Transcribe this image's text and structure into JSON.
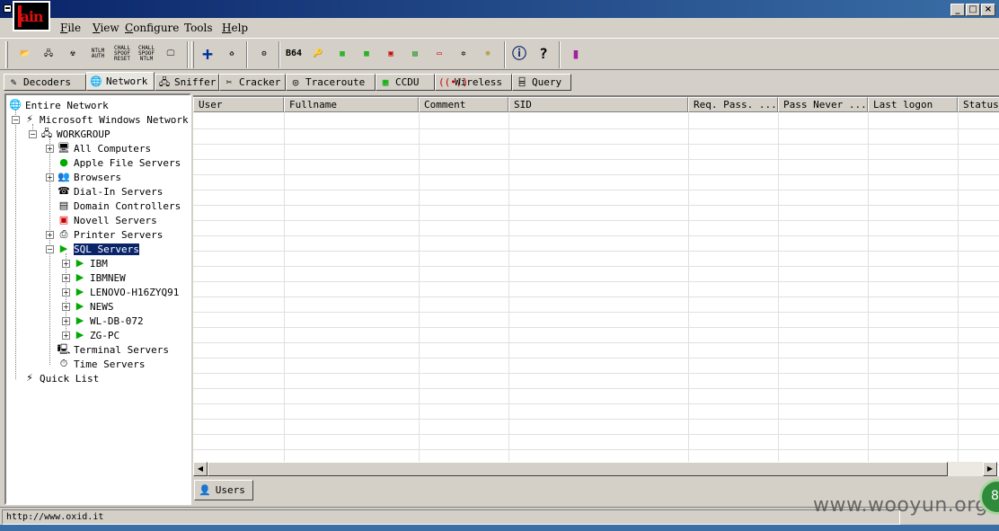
{
  "menu": {
    "items": [
      {
        "underline": "F",
        "rest": "ile"
      },
      {
        "underline": "V",
        "rest": "iew"
      },
      {
        "underline": "C",
        "rest": "onfigure"
      },
      {
        "underline": "",
        "rest": "Tools"
      },
      {
        "underline": "H",
        "rest": "elp"
      }
    ]
  },
  "toolbar": {
    "ntlm_auth": "NTLM AUTH",
    "chall_spoof_reset": "CHALL SPOOF RESET",
    "chall_spoof_ntlm": "CHALL SPOOF NTLM",
    "b64": "B64"
  },
  "tabs": [
    "Decoders",
    "Network",
    "Sniffer",
    "Cracker",
    "Traceroute",
    "CCDU",
    "Wireless",
    "Query"
  ],
  "tree": {
    "root": "Entire Network",
    "mwn": "Microsoft Windows Network",
    "workgroup": "WORKGROUP",
    "children": [
      "All Computers",
      "Apple File Servers",
      "Browsers",
      "Dial-In Servers",
      "Domain Controllers",
      "Novell Servers",
      "Printer Servers",
      "SQL Servers"
    ],
    "sql": [
      "IBM",
      "IBMNEW",
      "LENOVO-H16ZYQ91",
      "NEWS",
      "WL-DB-072",
      "ZG-PC"
    ],
    "after": [
      "Terminal Servers",
      "Time Servers"
    ],
    "quick": "Quick List"
  },
  "grid": {
    "columns": [
      "User",
      "Fullname",
      "Comment",
      "SID",
      "Req. Pass. ...",
      "Pass Never ...",
      "Last logon",
      "Status"
    ]
  },
  "subtab": "Users",
  "status": "http://www.oxid.it",
  "watermark": "www.wooyun.org",
  "badge": "8"
}
